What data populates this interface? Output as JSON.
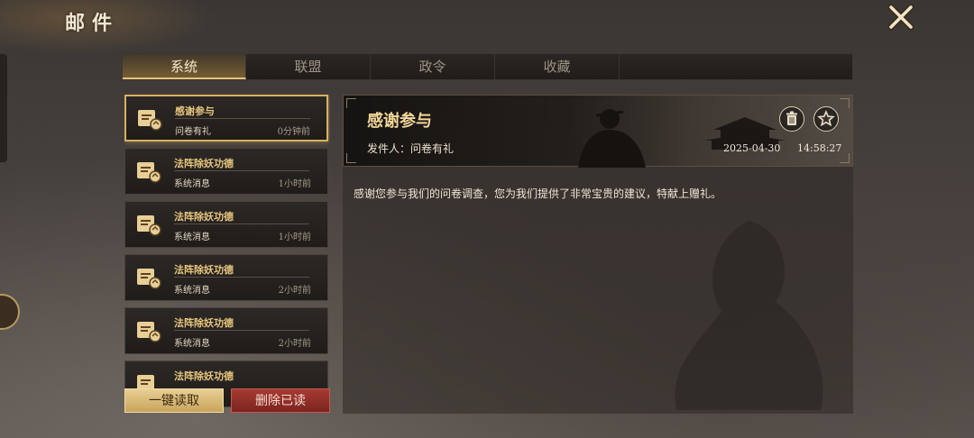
{
  "page": {
    "title": "邮件"
  },
  "tabs": [
    {
      "label": "系统",
      "active": true
    },
    {
      "label": "联盟",
      "active": false
    },
    {
      "label": "政令",
      "active": false
    },
    {
      "label": "收藏",
      "active": false
    }
  ],
  "mail_list": [
    {
      "subject": "感谢参与",
      "sender": "问卷有礼",
      "time": "0分钟前",
      "selected": true
    },
    {
      "subject": "法阵除妖功德",
      "sender": "系统消息",
      "time": "1小时前",
      "selected": false
    },
    {
      "subject": "法阵除妖功德",
      "sender": "系统消息",
      "time": "1小时前",
      "selected": false
    },
    {
      "subject": "法阵除妖功德",
      "sender": "系统消息",
      "time": "2小时前",
      "selected": false
    },
    {
      "subject": "法阵除妖功德",
      "sender": "系统消息",
      "time": "2小时前",
      "selected": false
    },
    {
      "subject": "法阵除妖功德",
      "sender": "",
      "time": "",
      "selected": false
    }
  ],
  "actions": {
    "read_all": "一键读取",
    "delete_read": "删除已读"
  },
  "detail": {
    "title": "感谢参与",
    "sender_line": "发件人：问卷有礼",
    "date": "2025-04-30",
    "time": "14:58:27",
    "body": "感谢您参与我们的问卷调查，您为我们提供了非常宝贵的建议，特献上赠礼。"
  },
  "icons": {
    "close": "close-icon",
    "trash": "trash-icon",
    "star": "star-icon",
    "mail": "mail-letter-icon"
  },
  "colors": {
    "accent_gold": "#e6c37a",
    "subject_gold": "#e6c57e",
    "delete_red": "#a63a32"
  }
}
